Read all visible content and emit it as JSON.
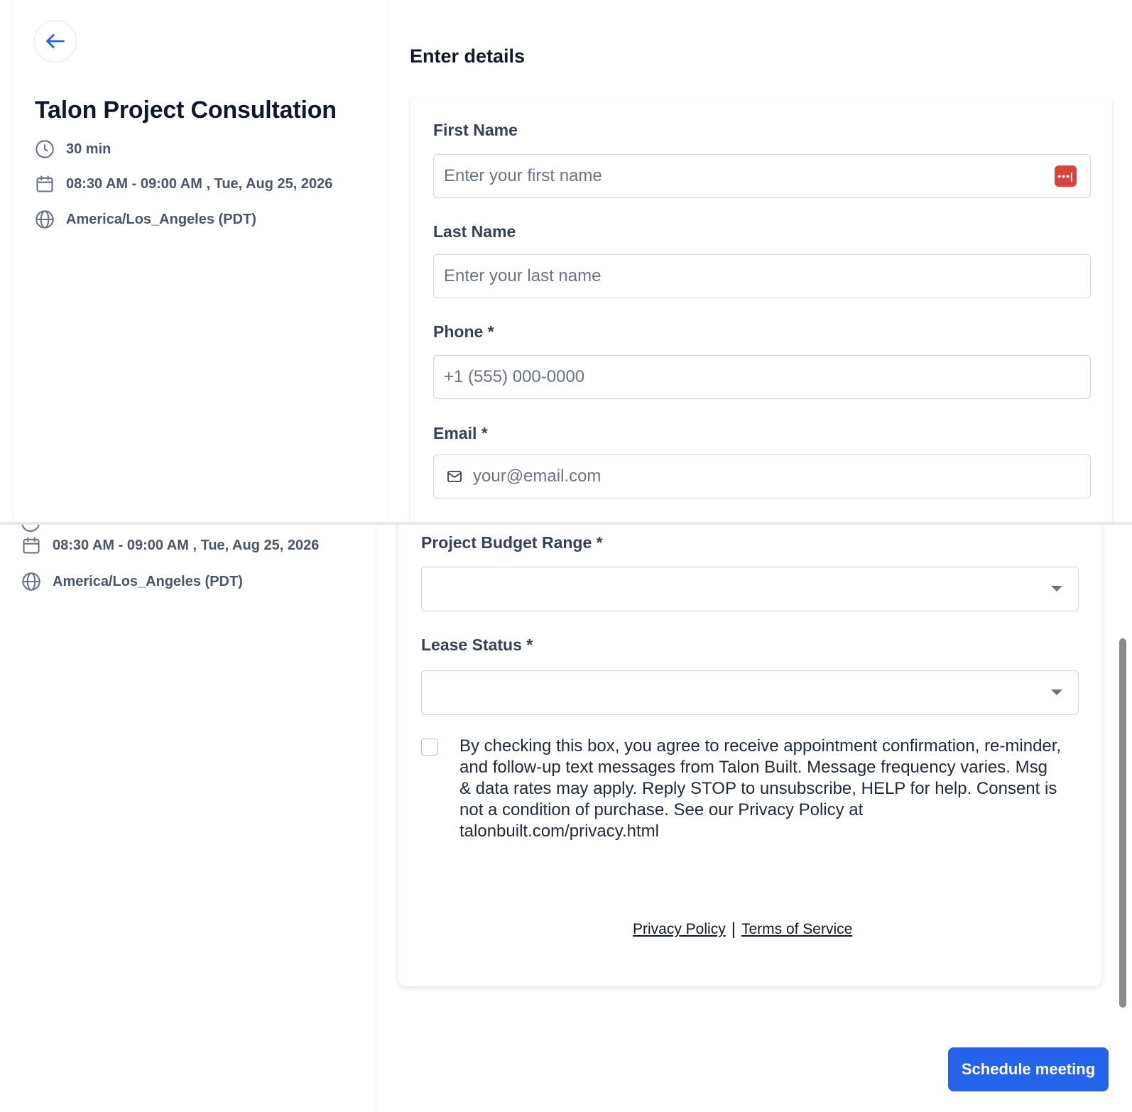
{
  "event": {
    "title": "Talon Project Consultation",
    "duration": "30 min",
    "datetime": "08:30 AM - 09:00 AM , Tue, Aug 25, 2026",
    "timezone": "America/Los_Angeles (PDT)"
  },
  "form": {
    "section_title": "Enter details",
    "first_name": {
      "label": "First Name",
      "placeholder": "Enter your first name",
      "value": ""
    },
    "last_name": {
      "label": "Last Name",
      "placeholder": "Enter your last name",
      "value": ""
    },
    "phone": {
      "label": "Phone *",
      "placeholder": "+1 (555) 000-0000",
      "value": ""
    },
    "email": {
      "label": "Email *",
      "placeholder": "your@email.com",
      "value": ""
    },
    "budget": {
      "label": "Project Budget Range *",
      "selected": ""
    },
    "lease": {
      "label": "Lease Status *",
      "selected": ""
    },
    "consent": {
      "checked": false,
      "text": "By checking this box, you agree to receive appointment confirmation, re-minder, and follow-up text messages from Talon Built. Message frequency varies. Msg & data rates may apply. Reply STOP to unsubscribe, HELP for help. Consent is not a condition of purchase. See our Privacy Policy at talonbuilt.com/privacy.html"
    }
  },
  "footer": {
    "privacy": "Privacy Policy",
    "separator": "|",
    "terms": "Terms of Service"
  },
  "actions": {
    "schedule": "Schedule meeting"
  },
  "colors": {
    "accent": "#2563eb",
    "autofill_badge": "#d9443a",
    "text_primary": "#111827",
    "text_muted": "#4b5563",
    "border": "#d1d5db"
  }
}
